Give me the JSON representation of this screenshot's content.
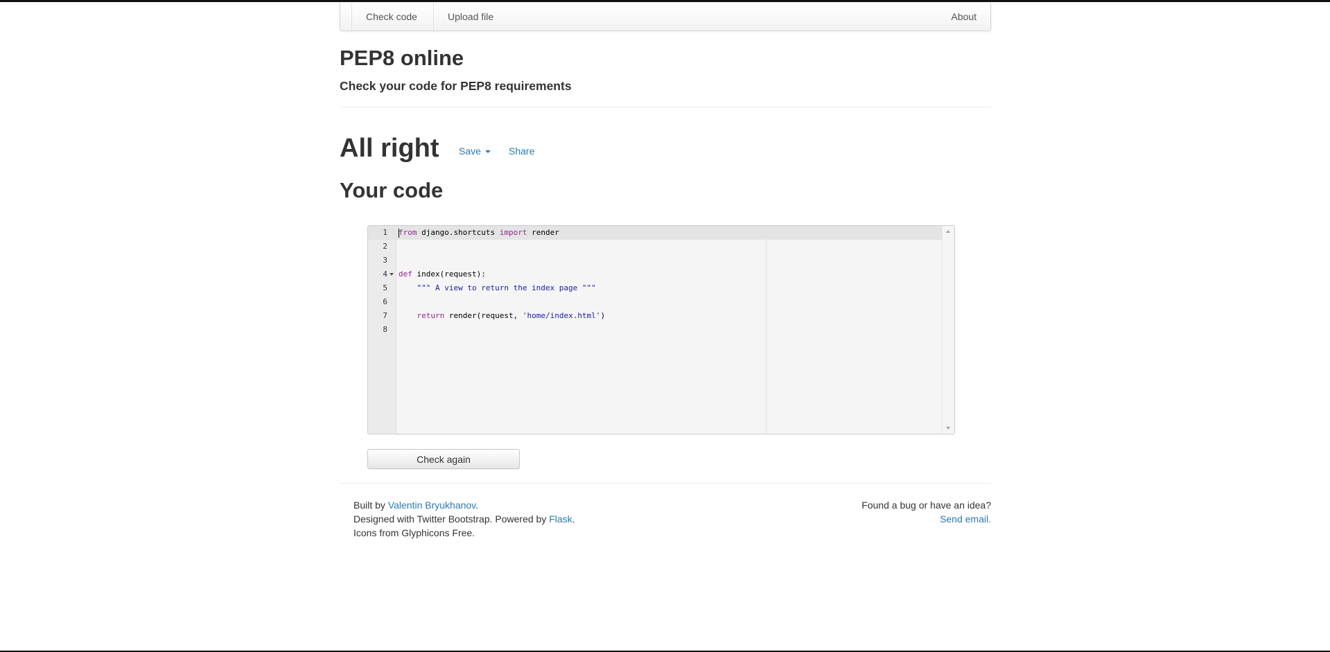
{
  "nav": {
    "check_code": "Check code",
    "upload_file": "Upload file",
    "about": "About"
  },
  "header": {
    "title": "PEP8 online",
    "subtitle": "Check your code for PEP8 requirements"
  },
  "result": {
    "status": "All right",
    "save_label": "Save",
    "share_label": "Share"
  },
  "code_section": {
    "title": "Your code",
    "check_again_label": "Check again"
  },
  "editor": {
    "active_line": 1,
    "lines": [
      {
        "num": "1",
        "text": "from django.shortcuts import render"
      },
      {
        "num": "2",
        "text": ""
      },
      {
        "num": "3",
        "text": ""
      },
      {
        "num": "4",
        "text": "def index(request):"
      },
      {
        "num": "5",
        "text": "    \"\"\" A view to return the index page \"\"\""
      },
      {
        "num": "6",
        "text": ""
      },
      {
        "num": "7",
        "text": "    return render(request, 'home/index.html')"
      },
      {
        "num": "8",
        "text": ""
      }
    ]
  },
  "footer": {
    "built_by": "Built by ",
    "author": "Valentin Bryukhanov",
    "designed": "Designed with Twitter Bootstrap. Powered by ",
    "flask": "Flask",
    "period": ".",
    "icons": "Icons from Glyphicons Free.",
    "bug_text": "Found a bug or have an idea?",
    "send_email": "Send email."
  },
  "colors": {
    "link": "#2a7ab0",
    "keyword": "#93278f",
    "string": "#1a1aa6",
    "text": "#333333"
  }
}
